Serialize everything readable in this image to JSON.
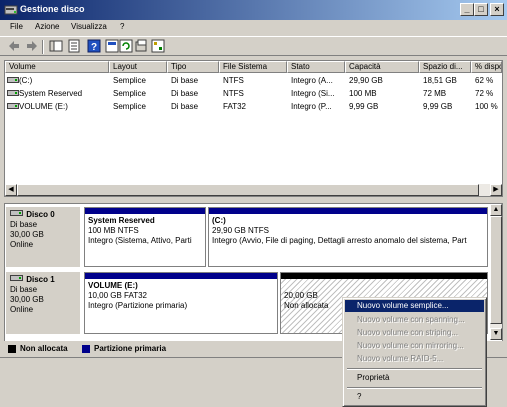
{
  "window": {
    "title": "Gestione disco",
    "minimize_label": "_",
    "maximize_label": "□",
    "close_label": "×"
  },
  "menubar": [
    "File",
    "Azione",
    "Visualizza",
    "?"
  ],
  "toolbar": {
    "icons": [
      "back-arrow-icon",
      "forward-arrow-icon",
      "console-tree-icon",
      "properties-icon",
      "help-icon",
      "help-topic-icon",
      "refresh-icon",
      "export-icon",
      "options-icon"
    ]
  },
  "volume_list": {
    "columns": [
      "Volume",
      "Layout",
      "Tipo",
      "File Sistema",
      "Stato",
      "Capacità",
      "Spazio di...",
      "% dispo"
    ],
    "rows": [
      [
        "(C:)",
        "Semplice",
        "Di base",
        "NTFS",
        "Integro (A...",
        "29,90 GB",
        "18,51 GB",
        "62 %"
      ],
      [
        "System Reserved",
        "Semplice",
        "Di base",
        "NTFS",
        "Integro (Si...",
        "100 MB",
        "72 MB",
        "72 %"
      ],
      [
        "VOLUME (E:)",
        "Semplice",
        "Di base",
        "FAT32",
        "Integro (P...",
        "9,99 GB",
        "9,99 GB",
        "100 %"
      ]
    ]
  },
  "disks": [
    {
      "name": "Disco 0",
      "type": "Di base",
      "size": "30,00 GB",
      "status": "Online",
      "partitions": [
        {
          "name": "System Reserved",
          "detail": "100 MB NTFS",
          "status": "Integro (Sistema, Attivo, Parti"
        },
        {
          "name": "(C:)",
          "detail": "29,90 GB NTFS",
          "status": "Integro (Avvio, File di paging, Dettagli arresto anomalo del sistema, Part"
        }
      ]
    },
    {
      "name": "Disco 1",
      "type": "Di base",
      "size": "30,00 GB",
      "status": "Online",
      "partitions": [
        {
          "name": "VOLUME  (E:)",
          "detail": "10,00 GB FAT32",
          "status": "Integro (Partizione primaria)"
        },
        {
          "name": "",
          "detail": "20,00 GB",
          "status": "Non allocata"
        }
      ]
    }
  ],
  "legend": [
    {
      "label": "Non allocata",
      "color": "#000000"
    },
    {
      "label": "Partizione primaria",
      "color": "#00008b"
    }
  ],
  "context_menu": {
    "items": [
      {
        "label": "Nuovo volume semplice...",
        "enabled": true,
        "highlighted": true
      },
      {
        "label": "Nuovo volume con spanning...",
        "enabled": false
      },
      {
        "label": "Nuovo volume con striping...",
        "enabled": false
      },
      {
        "label": "Nuovo volume con mirroring...",
        "enabled": false
      },
      {
        "label": "Nuovo volume RAID-5...",
        "enabled": false
      },
      {
        "label": "Proprietà",
        "enabled": true
      },
      {
        "label": "?",
        "enabled": true
      }
    ]
  },
  "colors": {
    "title_gradient_start": "#0a246a",
    "title_gradient_end": "#a6caf0",
    "primary_partition": "#00008b",
    "unallocated": "#000000",
    "highlight": "#0a246a",
    "desktop": "#3a6ea5"
  }
}
